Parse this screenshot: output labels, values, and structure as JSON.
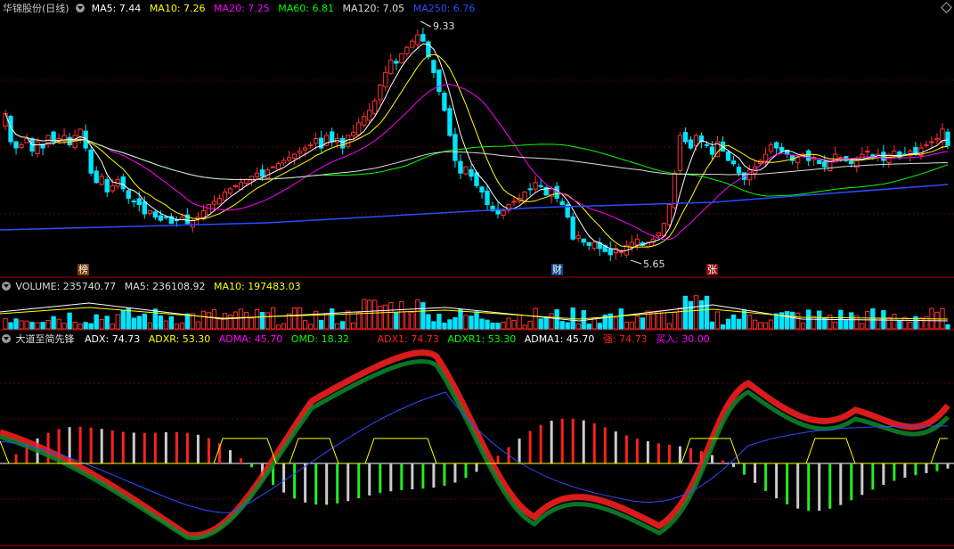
{
  "main": {
    "stock_name": "华锦股份(日线)",
    "indicators": [
      {
        "label": "MA5: 7.44",
        "color": "#ffffff"
      },
      {
        "label": "MA10: 7.26",
        "color": "#ffff00"
      },
      {
        "label": "MA20: 7.25",
        "color": "#ff00ff"
      },
      {
        "label": "MA60: 6.81",
        "color": "#00ff00"
      },
      {
        "label": "MA120: 7.05",
        "color": "#dddddd"
      },
      {
        "label": "MA250: 6.76",
        "color": "#2b4cff"
      }
    ],
    "high_label": "9.33",
    "low_label": "5.65",
    "markers": [
      {
        "text": "榜",
        "color": "#ffffff",
        "bg": "#7a3a00"
      },
      {
        "text": "财",
        "color": "#ffffff",
        "bg": "#0a4a8a"
      },
      {
        "text": "张",
        "color": "#ffffff",
        "bg": "#8a1010"
      }
    ]
  },
  "volume_panel": {
    "title": "VOLUME: 235740.77",
    "ma5": "MA5: 236108.92",
    "ma10": "MA10: 197483.03"
  },
  "indicator_panel": {
    "name": "大道至简先锋",
    "items": [
      {
        "label": "ADX: 74.73",
        "color": "#ffffff"
      },
      {
        "label": "ADXR: 53.30",
        "color": "#ffff00"
      },
      {
        "label": "ADMA: 45.70",
        "color": "#ff00ff"
      },
      {
        "label": "OMD: 18.32",
        "color": "#00ff00"
      },
      {
        "label": "ADX1: 74.73",
        "color": "#ff2020"
      },
      {
        "label": "ADXR1: 53.30",
        "color": "#00ff00"
      },
      {
        "label": "ADMA1: 45.70",
        "color": "#ffffff"
      },
      {
        "label": "强: 74.73",
        "color": "#ff2020"
      },
      {
        "label": "买入: 30.00",
        "color": "#ff00ff"
      }
    ]
  },
  "chart_data": {
    "type": "candlestick",
    "x": [
      0,
      1,
      2,
      3,
      4,
      5,
      6,
      7,
      8,
      9,
      10,
      11,
      12,
      13,
      14,
      15,
      16,
      17,
      18,
      19,
      20,
      21,
      22,
      23,
      24,
      25,
      26,
      27,
      28,
      29,
      30,
      31,
      32,
      33,
      34,
      35,
      36,
      37,
      38,
      39,
      40,
      41,
      42,
      43,
      44,
      45,
      46,
      47,
      48,
      49,
      50,
      51,
      52,
      53,
      54,
      55,
      56,
      57,
      58,
      59,
      60,
      61,
      62,
      63,
      64,
      65,
      66,
      67,
      68,
      69,
      70,
      71,
      72,
      73,
      74,
      75,
      76,
      77,
      78,
      79,
      80,
      81,
      82,
      83,
      84,
      85,
      86,
      87,
      88,
      89,
      90,
      91,
      92,
      93,
      94,
      95,
      96,
      97,
      98,
      99,
      100,
      101,
      102,
      103,
      104,
      105,
      106,
      107,
      108,
      109,
      110,
      111,
      112,
      113,
      114,
      115,
      116,
      117,
      118,
      119,
      120,
      121,
      122,
      123,
      124,
      125,
      126,
      127,
      128,
      129,
      130,
      131,
      132,
      133,
      134,
      135,
      136,
      137,
      138,
      139,
      140,
      141,
      142,
      143,
      144,
      145,
      146,
      147,
      148,
      149,
      150,
      151,
      152,
      153,
      154,
      155,
      156,
      157,
      158,
      159,
      160,
      161,
      162,
      163,
      164,
      165,
      166,
      167,
      168,
      169,
      170,
      171,
      172,
      173,
      174,
      175,
      176
    ],
    "close": [
      7.95,
      7.5,
      7.4,
      7.45,
      7.55,
      7.35,
      7.5,
      7.4,
      7.6,
      7.5,
      7.55,
      7.6,
      7.45,
      7.6,
      7.7,
      7.4,
      7.0,
      6.85,
      6.95,
      6.7,
      6.8,
      6.9,
      6.75,
      6.6,
      6.55,
      6.5,
      6.35,
      6.4,
      6.3,
      6.25,
      6.3,
      6.2,
      6.25,
      6.3,
      6.2,
      6.25,
      6.3,
      6.4,
      6.5,
      6.55,
      6.6,
      6.7,
      6.75,
      6.8,
      6.85,
      6.9,
      6.95,
      7.0,
      6.95,
      7.05,
      7.1,
      7.15,
      7.2,
      7.25,
      7.3,
      7.35,
      7.4,
      7.45,
      7.55,
      7.4,
      7.6,
      7.5,
      7.55,
      7.4,
      7.6,
      7.65,
      7.8,
      7.9,
      8.0,
      8.15,
      8.4,
      8.6,
      8.8,
      8.75,
      8.9,
      9.0,
      9.1,
      9.2,
      9.1,
      8.85,
      8.6,
      8.3,
      8.0,
      7.6,
      7.2,
      7.0,
      7.1,
      6.95,
      6.8,
      6.7,
      6.5,
      6.4,
      6.35,
      6.4,
      6.5,
      6.55,
      6.6,
      6.7,
      6.75,
      6.85,
      6.8,
      6.65,
      6.75,
      6.6,
      6.5,
      6.3,
      5.95,
      6.0,
      5.9,
      5.85,
      5.9,
      5.8,
      5.75,
      5.7,
      5.8,
      5.75,
      5.85,
      5.9,
      5.95,
      5.85,
      5.9,
      5.95,
      6.05,
      6.2,
      6.5,
      7.0,
      7.6,
      7.5,
      7.4,
      7.6,
      7.5,
      7.45,
      7.3,
      7.5,
      7.35,
      7.2,
      7.15,
      7.0,
      6.9,
      7.05,
      7.1,
      7.2,
      7.3,
      7.45,
      7.4,
      7.35,
      7.3,
      7.2,
      7.25,
      7.3,
      7.2,
      7.25,
      7.15,
      7.1,
      7.2,
      7.3,
      7.25,
      7.2,
      7.15,
      7.2,
      7.3,
      7.35,
      7.25,
      7.3,
      7.2,
      7.3,
      7.35,
      7.25,
      7.3,
      7.35,
      7.3,
      7.4,
      7.45,
      7.5,
      7.55,
      7.7,
      7.44
    ],
    "yrange": [
      5.5,
      9.5
    ],
    "high": 9.33,
    "low": 5.65
  }
}
